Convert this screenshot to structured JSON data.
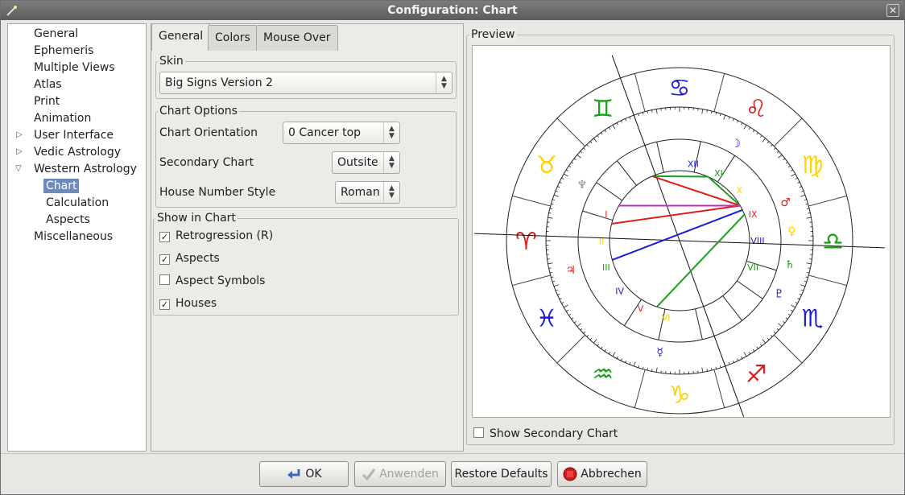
{
  "window": {
    "title": "Configuration: Chart"
  },
  "sidebar": {
    "items": [
      {
        "label": "General"
      },
      {
        "label": "Ephemeris"
      },
      {
        "label": "Multiple Views"
      },
      {
        "label": "Atlas"
      },
      {
        "label": "Print"
      },
      {
        "label": "Animation"
      },
      {
        "label": "User Interface"
      },
      {
        "label": "Vedic Astrology"
      },
      {
        "label": "Western Astrology"
      },
      {
        "label": "Chart"
      },
      {
        "label": "Calculation"
      },
      {
        "label": "Aspects"
      },
      {
        "label": "Miscellaneous"
      }
    ],
    "selected": "Chart"
  },
  "tabs": [
    {
      "label": "General"
    },
    {
      "label": "Colors"
    },
    {
      "label": "Mouse Over"
    }
  ],
  "skin": {
    "title": "Skin",
    "value": "Big Signs Version 2"
  },
  "chart_options": {
    "title": "Chart Options",
    "orientation": {
      "label": "Chart Orientation",
      "value": "0 Cancer top"
    },
    "secondary": {
      "label": "Secondary Chart",
      "value": "Outsite"
    },
    "house_style": {
      "label": "House Number Style",
      "value": "Roman"
    }
  },
  "show_in_chart": {
    "title": "Show in Chart",
    "items": [
      {
        "label": "Retrogression (R)",
        "checked": true
      },
      {
        "label": "Aspects",
        "checked": true
      },
      {
        "label": "Aspect Symbols",
        "checked": false
      },
      {
        "label": "Houses",
        "checked": true
      }
    ]
  },
  "preview": {
    "title": "Preview",
    "show_secondary": {
      "label": "Show Secondary Chart",
      "checked": false
    },
    "houses": [
      "I",
      "II",
      "III",
      "IV",
      "V",
      "VI",
      "VII",
      "VIII",
      "IX",
      "X",
      "XI",
      "XII"
    ],
    "signs": [
      "♋",
      "♊",
      "♉",
      "♈",
      "♓",
      "♒",
      "♑",
      "♐",
      "♏",
      "♎",
      "♍",
      "♌"
    ],
    "sign_colors": [
      "#1a1adc",
      "#19a019",
      "#ffd200",
      "#e01a1a",
      "#1a1adc",
      "#19a019",
      "#ffd200",
      "#e01a1a",
      "#1a1adc",
      "#19a019",
      "#ffd200",
      "#e01a1a"
    ],
    "retro_mark": "R"
  },
  "buttons": {
    "ok": "OK",
    "apply": "Anwenden",
    "restore": "Restore Defaults",
    "cancel": "Abbrechen"
  },
  "colors": {
    "accent": "#6d8bbd"
  }
}
